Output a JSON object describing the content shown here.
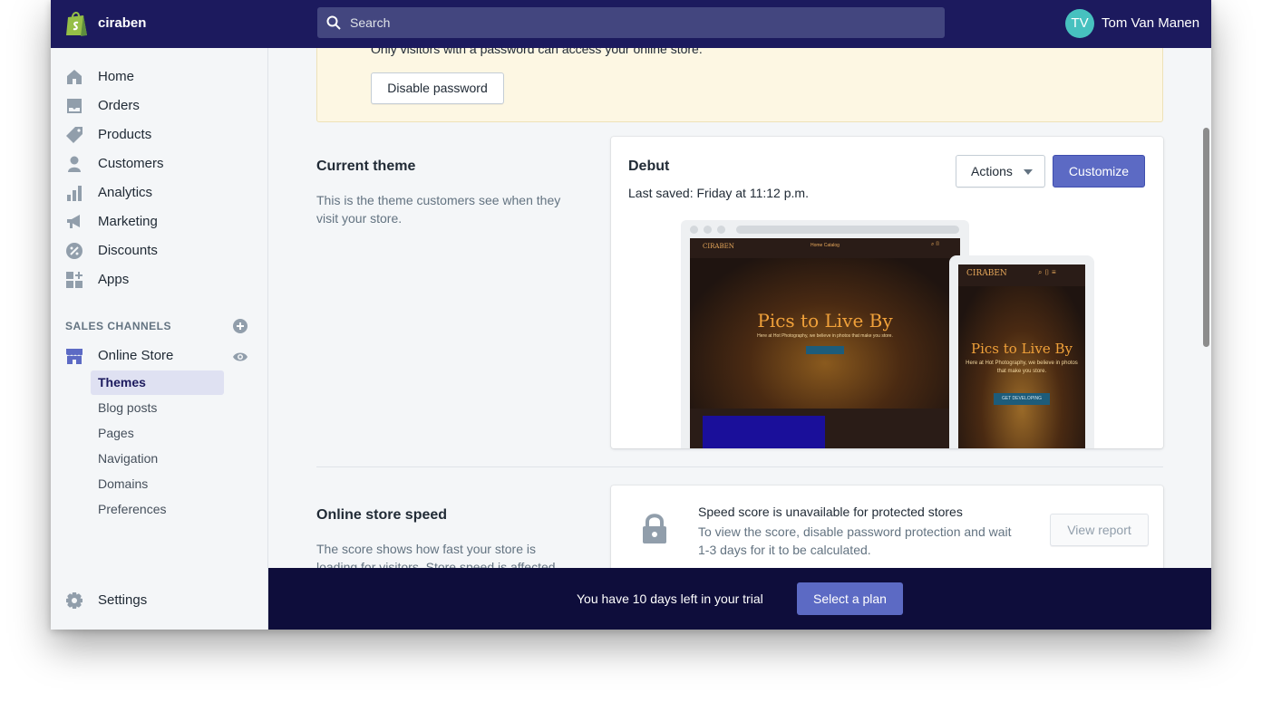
{
  "topbar": {
    "store_name": "ciraben",
    "search_placeholder": "Search",
    "user_initials": "TV",
    "user_name": "Tom Van Manen"
  },
  "sidebar": {
    "items": [
      {
        "label": "Home",
        "icon": "home-icon"
      },
      {
        "label": "Orders",
        "icon": "orders-icon"
      },
      {
        "label": "Products",
        "icon": "tag-icon"
      },
      {
        "label": "Customers",
        "icon": "person-icon"
      },
      {
        "label": "Analytics",
        "icon": "bar-chart-icon"
      },
      {
        "label": "Marketing",
        "icon": "megaphone-icon"
      },
      {
        "label": "Discounts",
        "icon": "discount-icon"
      },
      {
        "label": "Apps",
        "icon": "apps-icon"
      }
    ],
    "sales_channels_title": "SALES CHANNELS",
    "online_store": "Online Store",
    "sub_items": [
      {
        "label": "Themes",
        "active": true
      },
      {
        "label": "Blog posts"
      },
      {
        "label": "Pages"
      },
      {
        "label": "Navigation"
      },
      {
        "label": "Domains"
      },
      {
        "label": "Preferences"
      }
    ],
    "settings": "Settings"
  },
  "banner": {
    "text": "Only visitors with a password can access your online store.",
    "button": "Disable password"
  },
  "current_theme": {
    "title": "Current theme",
    "description": "This is the theme customers see when they visit your store.",
    "theme_name": "Debut",
    "last_saved": "Last saved: Friday at 11:12 p.m.",
    "actions_label": "Actions",
    "customize_label": "Customize",
    "preview": {
      "desktop_logo": "CIRABEN",
      "desktop_nav": "Home   Catalog",
      "hero_title": "Pics to Live By",
      "hero_subtitle": "Here at Hot Photography, we believe in photos that make you store.",
      "mobile_logo": "CIRABEN",
      "mobile_subtitle": "Here at Hot Photography, we believe in photos that make you store.",
      "cta": "GET DEVELOPING"
    }
  },
  "speed": {
    "title": "Online store speed",
    "description": "The score shows how fast your store is loading for visitors. Store speed is affected",
    "card_title": "Speed score is unavailable for protected stores",
    "card_text": "To view the score, disable password protection and wait 1-3 days for it to be calculated.",
    "view_report": "View report"
  },
  "trial": {
    "text": "You have 10 days left in your trial",
    "button": "Select a plan"
  },
  "colors": {
    "topbar": "#1c1a5e",
    "accent": "#5c6ac4",
    "trialbar": "#0e0d3b",
    "banner": "#fdf7e3"
  }
}
